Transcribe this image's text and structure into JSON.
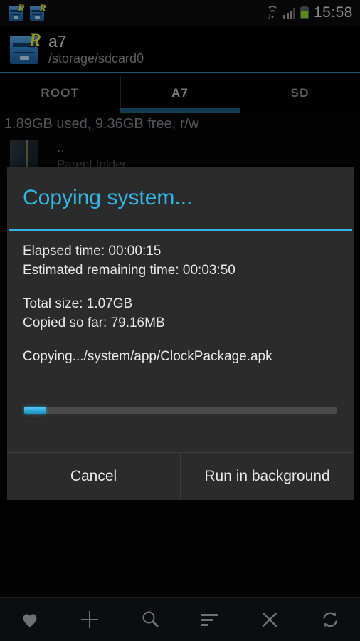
{
  "statusbar": {
    "notification_icons": [
      "root-explorer-icon",
      "root-explorer-icon"
    ],
    "wifi_icon": "wifi-download-icon",
    "signal_icon": "signal-bars-icon",
    "battery_icon": "battery-icon",
    "time": "15:58"
  },
  "header": {
    "app_icon": "root-explorer-icon",
    "title": "a7",
    "path": "/storage/sdcard0"
  },
  "tabs": {
    "items": [
      {
        "label": "ROOT",
        "selected": false
      },
      {
        "label": "A7",
        "selected": true
      },
      {
        "label": "SD",
        "selected": false
      }
    ]
  },
  "filelist": {
    "storage_info": "1.89GB used, 9.36GB free, r/w",
    "rows": [
      {
        "icon": "folder-icon",
        "name": "..",
        "subtitle": "Parent folder"
      }
    ]
  },
  "dialog": {
    "title": "Copying system...",
    "accent_color": "#33b5e5",
    "lines": [
      "Elapsed time: 00:00:15",
      "Estimated remaining time: 00:03:50"
    ],
    "size_lines": [
      "Total size: 1.07GB",
      "Copied so far: 79.16MB"
    ],
    "current_file": "Copying.../system/app/ClockPackage.apk",
    "progress_percent": 7,
    "buttons": [
      {
        "label": "Cancel"
      },
      {
        "label": "Run in background"
      }
    ]
  },
  "toolbar": {
    "items": [
      {
        "icon": "heart-icon"
      },
      {
        "icon": "plus-icon"
      },
      {
        "icon": "search-icon"
      },
      {
        "icon": "sort-icon"
      },
      {
        "icon": "close-icon"
      },
      {
        "icon": "refresh-icon"
      }
    ]
  }
}
